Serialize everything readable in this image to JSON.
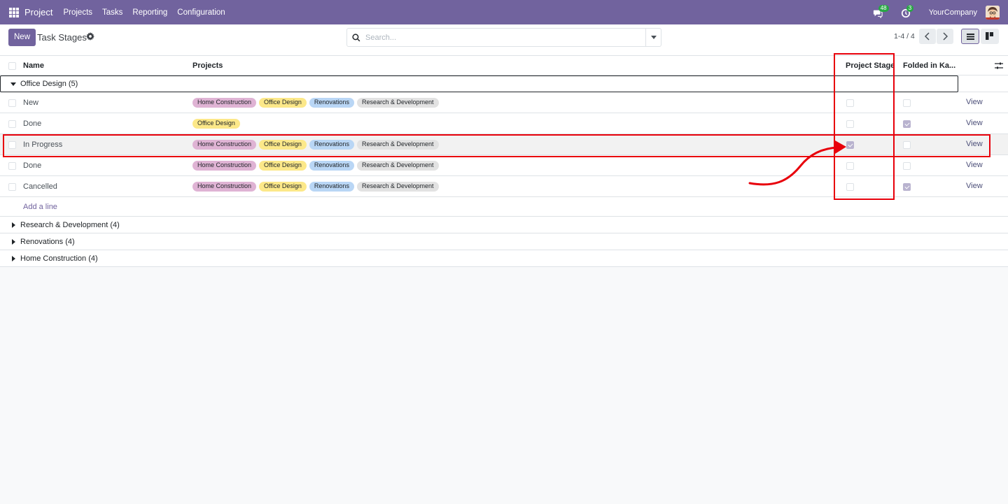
{
  "navbar": {
    "brand": "Project",
    "menu": [
      "Projects",
      "Tasks",
      "Reporting",
      "Configuration"
    ],
    "messages_badge": "48",
    "activities_badge": "3",
    "company": "YourCompany",
    "color": "#71639e"
  },
  "control": {
    "new_label": "New",
    "title": "Task Stages",
    "search_placeholder": "Search...",
    "pager": "1-4 / 4"
  },
  "columns": {
    "name": "Name",
    "projects": "Projects",
    "project_stage": "Project Stage",
    "folded": "Folded in Ka..."
  },
  "tag_colors": {
    "Home Construction": "#dfb3d4",
    "Office Design": "#fce889",
    "Renovations": "#b9d6f5",
    "Research & Development": "#e2e2e2"
  },
  "groups": [
    {
      "label": "Office Design (5)",
      "expanded": true,
      "rows": [
        {
          "name": "New",
          "projects": [
            "Home Construction",
            "Office Design",
            "Renovations",
            "Research & Development"
          ],
          "project_stage": false,
          "folded": false,
          "action": "View"
        },
        {
          "name": "Done",
          "projects": [
            "Office Design"
          ],
          "project_stage": false,
          "folded": true,
          "action": "View"
        },
        {
          "name": "In Progress",
          "projects": [
            "Home Construction",
            "Office Design",
            "Renovations",
            "Research & Development"
          ],
          "project_stage": true,
          "folded": false,
          "action": "View"
        },
        {
          "name": "Done",
          "projects": [
            "Home Construction",
            "Office Design",
            "Renovations",
            "Research & Development"
          ],
          "project_stage": false,
          "folded": false,
          "action": "View"
        },
        {
          "name": "Cancelled",
          "projects": [
            "Home Construction",
            "Office Design",
            "Renovations",
            "Research & Development"
          ],
          "project_stage": false,
          "folded": true,
          "action": "View"
        }
      ],
      "add_line": "Add a line"
    },
    {
      "label": "Research & Development (4)",
      "expanded": false
    },
    {
      "label": "Renovations (4)",
      "expanded": false
    },
    {
      "label": "Home Construction (4)",
      "expanded": false
    }
  ],
  "annotation_color": "#e8000b"
}
